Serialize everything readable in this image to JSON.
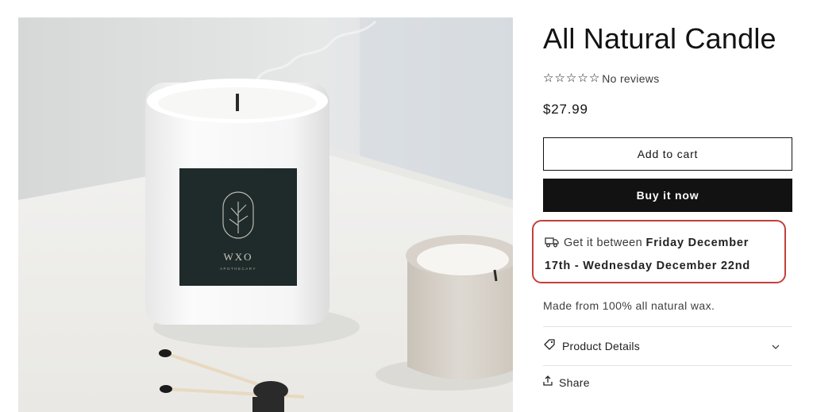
{
  "product": {
    "title": "All Natural Candle",
    "rating": {
      "stars": 5,
      "filled": 0,
      "label": "No reviews"
    },
    "price": "$27.99",
    "add_to_cart_label": "Add to cart",
    "buy_now_label": "Buy it now",
    "delivery": {
      "prefix": "Get it between ",
      "window": "Friday December 17th - Wednesday December 22nd",
      "icon": "truck-icon",
      "highlight_color": "#c0403b"
    },
    "description": "Made from 100% all natural wax.",
    "details_label": "Product Details",
    "share_label": "Share"
  },
  "image": {
    "label_text": "WXO",
    "label_subtext": "APOTHECARY"
  },
  "colors": {
    "button_dark": "#121212",
    "accent_red": "#c0403b"
  }
}
